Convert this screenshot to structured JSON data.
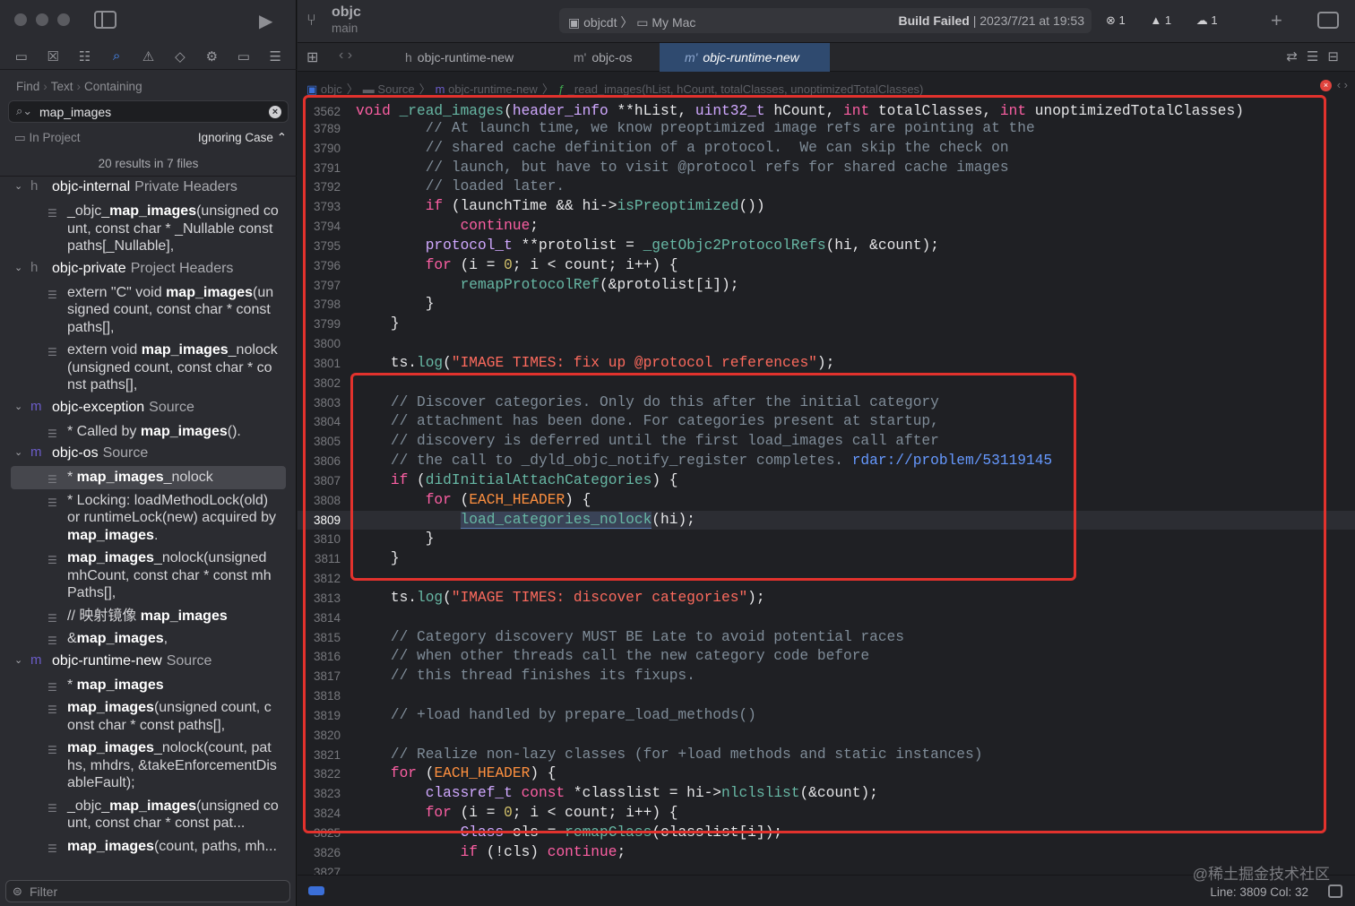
{
  "sidebar": {
    "find_path": [
      "Find",
      "Text",
      "Containing"
    ],
    "search_value": "map_images",
    "scope_label": "In Project",
    "case_label": "Ignoring Case",
    "summary": "20 results in 7 files",
    "filter_placeholder": "Filter"
  },
  "results": [
    {
      "type": "file",
      "icon": "h",
      "name": "objc-internal",
      "kind": "Private Headers"
    },
    {
      "type": "match",
      "pre": "_objc_",
      "term": "map_images",
      "post": "(unsigned count, const char * _Nullable const paths[_Nullable],"
    },
    {
      "type": "file",
      "icon": "h",
      "name": "objc-private",
      "kind": "Project Headers"
    },
    {
      "type": "match",
      "pre": "extern \"C\" void ",
      "term": "map_images",
      "post": "(unsigned count, const char * const paths[],"
    },
    {
      "type": "match",
      "pre": "extern void ",
      "term": "map_images",
      "post": "_nolock(unsigned count, const char * const paths[],"
    },
    {
      "type": "file",
      "icon": "m",
      "name": "objc-exception",
      "kind": "Source"
    },
    {
      "type": "match",
      "pre": "* Called by ",
      "term": "map_images",
      "post": "()."
    },
    {
      "type": "file",
      "icon": "m",
      "name": "objc-os",
      "kind": "Source"
    },
    {
      "type": "match",
      "pre": "* ",
      "term": "map_images",
      "post": "_nolock",
      "selected": true
    },
    {
      "type": "match",
      "pre": "* Locking: loadMethodLock(old) or runtimeLock(new) acquired by ",
      "term": "map_images",
      "post": "."
    },
    {
      "type": "match",
      "pre": "",
      "term": "map_images",
      "post": "_nolock(unsigned mhCount, const char * const mhPaths[],"
    },
    {
      "type": "match",
      "pre": "// 映射镜像 ",
      "term": "map_images",
      "post": ""
    },
    {
      "type": "match",
      "pre": "&",
      "term": "map_images",
      "post": ","
    },
    {
      "type": "file",
      "icon": "m",
      "name": "objc-runtime-new",
      "kind": "Source"
    },
    {
      "type": "match",
      "pre": "* ",
      "term": "map_images",
      "post": ""
    },
    {
      "type": "match",
      "pre": "",
      "term": "map_images",
      "post": "(unsigned count, const char * const paths[],"
    },
    {
      "type": "match",
      "pre": "",
      "term": "map_images",
      "post": "_nolock(count, paths, mhdrs, &takeEnforcementDisableFault);"
    },
    {
      "type": "match",
      "pre": "_objc_",
      "term": "map_images",
      "post": "(unsigned count, const char * const pat..."
    },
    {
      "type": "match",
      "pre": "",
      "term": "map_images",
      "post": "(count, paths, mh..."
    }
  ],
  "titlebar": {
    "project": "objc",
    "branch": "main",
    "scheme": "objcdt",
    "destination": "My Mac",
    "build_status_bold": "Build Failed",
    "build_time": "| 2023/7/21 at 19:53",
    "errors": "1",
    "warnings": "1",
    "issues": "1"
  },
  "tabs": [
    {
      "icon": "h",
      "label": "objc-runtime-new",
      "active": false
    },
    {
      "icon": "m",
      "label": "objc-os",
      "active": false
    },
    {
      "icon": "m",
      "label": "objc-runtime-new",
      "active": true
    }
  ],
  "jumpbar": [
    "objc",
    "Source",
    "objc-runtime-new",
    "_read_images(hList, hCount, totalClasses, unoptimizedTotalClasses)"
  ],
  "sticky_line": {
    "number": "3562",
    "html": "<span class=\"kw\">void</span> <span class=\"fn\">_read_images</span>(<span class=\"ty\">header_info</span> **hList, <span class=\"ty\">uint32_t</span> hCount, <span class=\"kw\">int</span> totalClasses, <span class=\"kw\">int</span> unoptimizedTotalClasses)"
  },
  "code_lines": [
    {
      "n": "3789",
      "html": "        <span class=\"cm\">// At launch time, we know preoptimized image refs are pointing at the</span>"
    },
    {
      "n": "3790",
      "html": "        <span class=\"cm\">// shared cache definition of a protocol.  We can skip the check on</span>"
    },
    {
      "n": "3791",
      "html": "        <span class=\"cm\">// launch, but have to visit @protocol refs for shared cache images</span>"
    },
    {
      "n": "3792",
      "html": "        <span class=\"cm\">// loaded later.</span>"
    },
    {
      "n": "3793",
      "html": "        <span class=\"kw\">if</span> (launchTime &amp;&amp; hi-&gt;<span class=\"fn\">isPreoptimized</span>())"
    },
    {
      "n": "3794",
      "html": "            <span class=\"kw\">continue</span>;"
    },
    {
      "n": "3795",
      "html": "        <span class=\"ty\">protocol_t</span> **protolist = <span class=\"fn\">_getObjc2ProtocolRefs</span>(hi, &amp;count);"
    },
    {
      "n": "3796",
      "html": "        <span class=\"kw\">for</span> (i = <span class=\"num\">0</span>; i &lt; count; i++) {"
    },
    {
      "n": "3797",
      "html": "            <span class=\"fn\">remapProtocolRef</span>(&amp;protolist[i]);"
    },
    {
      "n": "3798",
      "html": "        }"
    },
    {
      "n": "3799",
      "html": "    }"
    },
    {
      "n": "3800",
      "html": ""
    },
    {
      "n": "3801",
      "html": "    ts.<span class=\"fn\">log</span>(<span class=\"str\">\"IMAGE TIMES: fix up @protocol references\"</span>);"
    },
    {
      "n": "3802",
      "html": ""
    },
    {
      "n": "3803",
      "html": "    <span class=\"cm\">// Discover categories. Only do this after the initial category</span>"
    },
    {
      "n": "3804",
      "html": "    <span class=\"cm\">// attachment has been done. For categories present at startup,</span>"
    },
    {
      "n": "3805",
      "html": "    <span class=\"cm\">// discovery is deferred until the first load_images call after</span>"
    },
    {
      "n": "3806",
      "html": "    <span class=\"cm\">// the call to _dyld_objc_notify_register completes. </span><span class=\"lk\">rdar://problem/53119145</span>"
    },
    {
      "n": "3807",
      "html": "    <span class=\"kw\">if</span> (<span class=\"fn\">didInitialAttachCategories</span>) {"
    },
    {
      "n": "3808",
      "html": "        <span class=\"kw\">for</span> (<span class=\"mac\">EACH_HEADER</span>) {"
    },
    {
      "n": "3809",
      "html": "            <span class=\"fn hl\">load_categories_nolock</span>(hi);",
      "current": true
    },
    {
      "n": "3810",
      "html": "        }"
    },
    {
      "n": "3811",
      "html": "    }"
    },
    {
      "n": "3812",
      "html": ""
    },
    {
      "n": "3813",
      "html": "    ts.<span class=\"fn\">log</span>(<span class=\"str\">\"IMAGE TIMES: discover categories\"</span>);"
    },
    {
      "n": "3814",
      "html": ""
    },
    {
      "n": "3815",
      "html": "    <span class=\"cm\">// Category discovery MUST BE Late to avoid potential races</span>"
    },
    {
      "n": "3816",
      "html": "    <span class=\"cm\">// when other threads call the new category code before</span>"
    },
    {
      "n": "3817",
      "html": "    <span class=\"cm\">// this thread finishes its fixups.</span>"
    },
    {
      "n": "3818",
      "html": ""
    },
    {
      "n": "3819",
      "html": "    <span class=\"cm\">// +load handled by prepare_load_methods()</span>"
    },
    {
      "n": "3820",
      "html": ""
    },
    {
      "n": "3821",
      "html": "    <span class=\"cm\">// Realize non-lazy classes (for +load methods and static instances)</span>"
    },
    {
      "n": "3822",
      "html": "    <span class=\"kw\">for</span> (<span class=\"mac\">EACH_HEADER</span>) {"
    },
    {
      "n": "3823",
      "html": "        <span class=\"ty\">classref_t</span> <span class=\"kw\">const</span> *classlist = hi-&gt;<span class=\"fn\">nlclslist</span>(&amp;count);"
    },
    {
      "n": "3824",
      "html": "        <span class=\"kw\">for</span> (i = <span class=\"num\">0</span>; i &lt; count; i++) {"
    },
    {
      "n": "3825",
      "html": "            <span class=\"ty\">Class</span> cls = <span class=\"fn\">remapClass</span>(classlist[i]);"
    },
    {
      "n": "3826",
      "html": "            <span class=\"kw\">if</span> (!cls) <span class=\"kw\">continue</span>;"
    },
    {
      "n": "3827",
      "html": ""
    }
  ],
  "status": {
    "line_col": "Line: 3809  Col: 32"
  },
  "watermark": "@稀土掘金技术社区",
  "colors": {
    "accent": "#4a90ff",
    "annotation_red": "#e2322d",
    "active_tab": "#2f4a6f"
  }
}
